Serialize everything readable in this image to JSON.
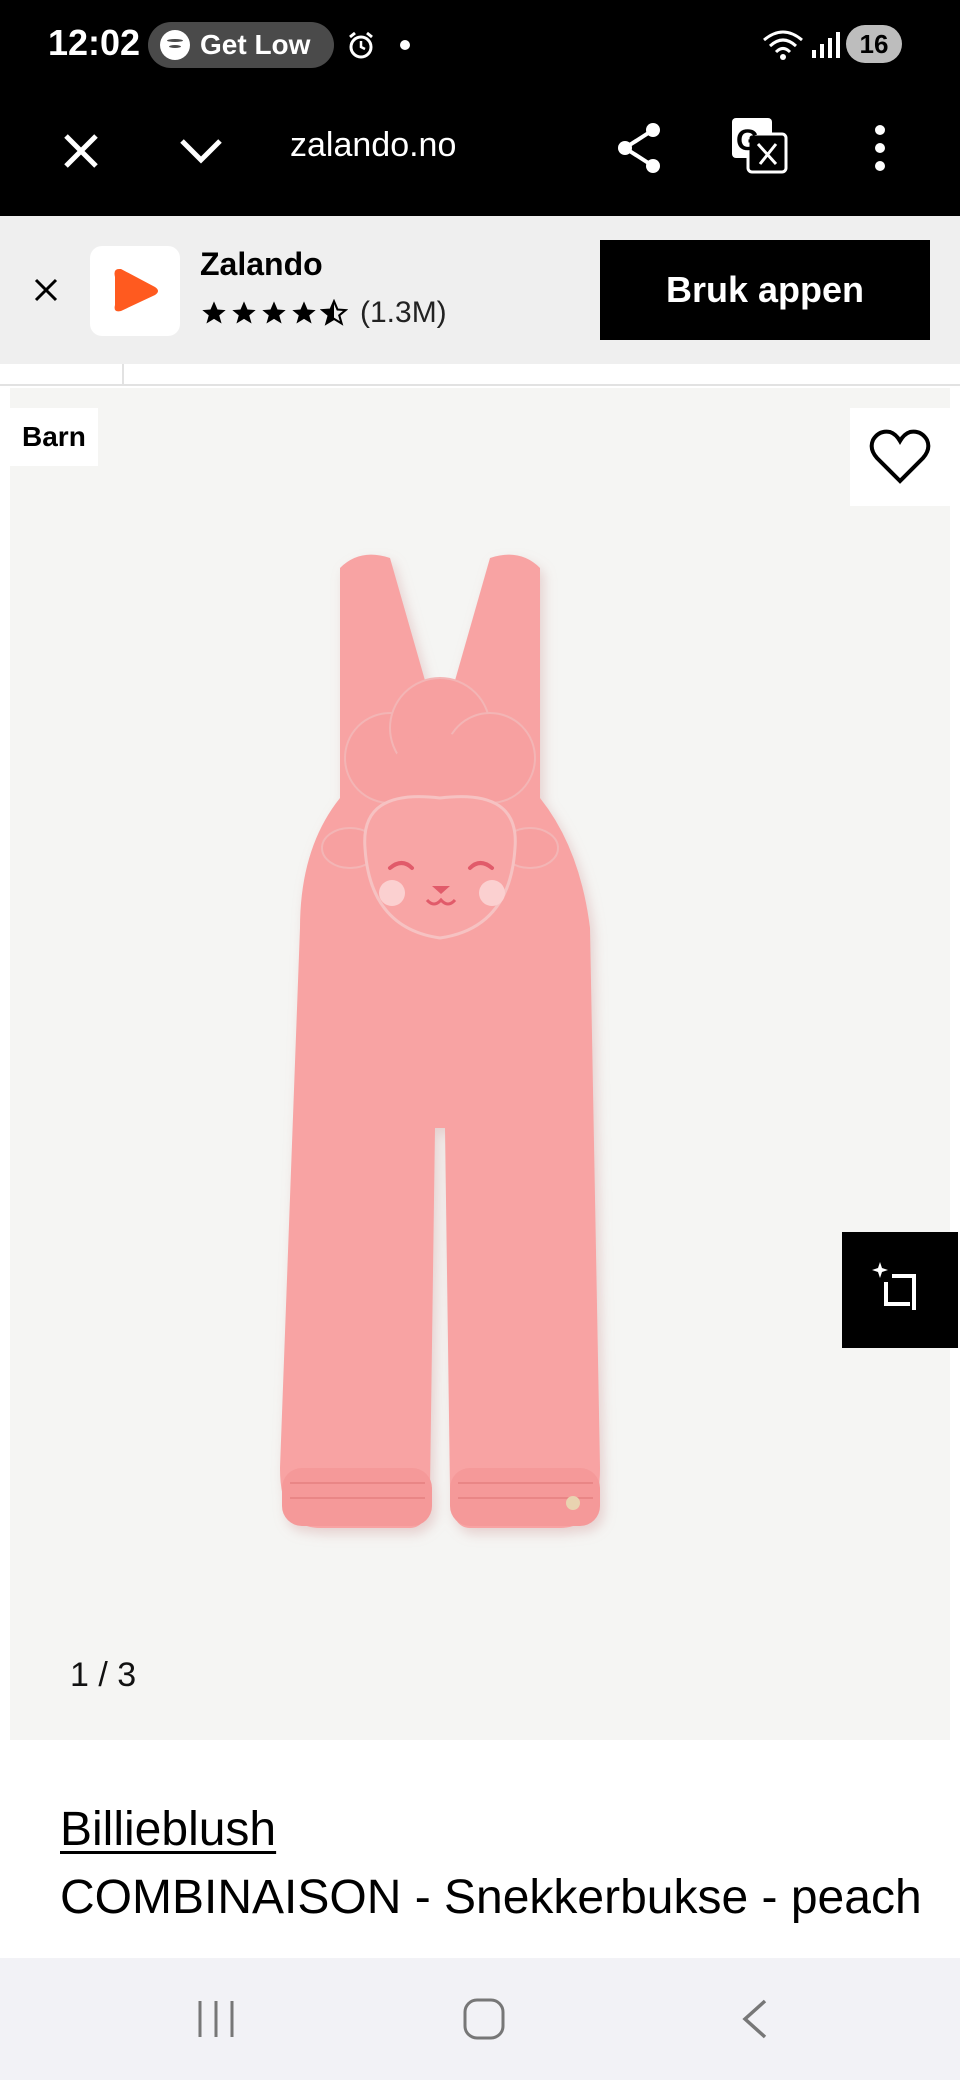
{
  "status_bar": {
    "time": "12:02",
    "media_title": "Get Low",
    "battery": "16"
  },
  "browser": {
    "url": "zalando.no"
  },
  "app_banner": {
    "app_name": "Zalando",
    "rating_count": "(1.3M)",
    "rating_stars": 4.5,
    "cta_label": "Bruk appen",
    "brand_color": "#ff6900"
  },
  "gallery": {
    "badge": "Barn",
    "counter": "1 / 3",
    "product_color": "#f8a3a3"
  },
  "product": {
    "brand": "Billieblush",
    "name": "COMBINAISON - Snekkerbukse - peach"
  }
}
